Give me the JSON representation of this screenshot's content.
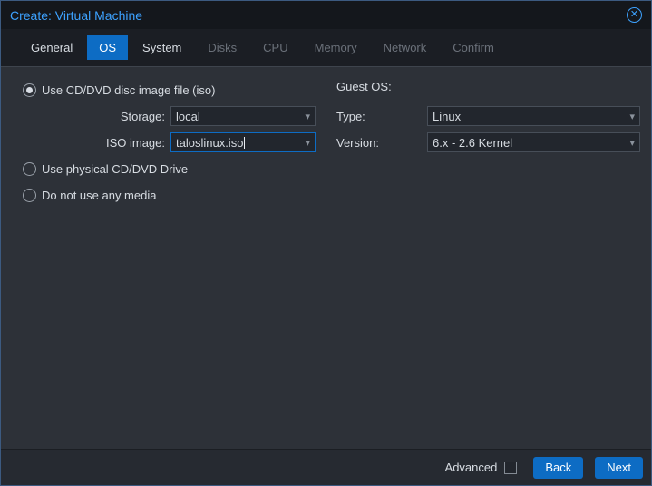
{
  "window": {
    "title": "Create: Virtual Machine"
  },
  "tabs": [
    {
      "label": "General"
    },
    {
      "label": "OS"
    },
    {
      "label": "System"
    },
    {
      "label": "Disks"
    },
    {
      "label": "CPU"
    },
    {
      "label": "Memory"
    },
    {
      "label": "Network"
    },
    {
      "label": "Confirm"
    }
  ],
  "media": {
    "radio_iso": {
      "label": "Use CD/DVD disc image file (iso)",
      "selected": true
    },
    "radio_physical": {
      "label": "Use physical CD/DVD Drive",
      "selected": false
    },
    "radio_none": {
      "label": "Do not use any media",
      "selected": false
    },
    "storage": {
      "label": "Storage:",
      "value": "local"
    },
    "iso_image": {
      "label": "ISO image:",
      "value": "taloslinux.iso"
    }
  },
  "guest_os": {
    "header": "Guest OS:",
    "type": {
      "label": "Type:",
      "value": "Linux"
    },
    "version": {
      "label": "Version:",
      "value": "6.x - 2.6 Kernel"
    }
  },
  "footer": {
    "advanced_label": "Advanced",
    "advanced_checked": false,
    "back_label": "Back",
    "next_label": "Next"
  },
  "icons": {
    "close": "close-circle-icon",
    "dropdown": "chevron-down-icon"
  },
  "colors": {
    "accent": "#0d6cc4",
    "title_blue": "#3da2ff",
    "body_bg": "#2d3138",
    "titlebar_bg": "#14171c",
    "tabbar_bg": "#1b1e24",
    "field_bg": "#22262d"
  }
}
